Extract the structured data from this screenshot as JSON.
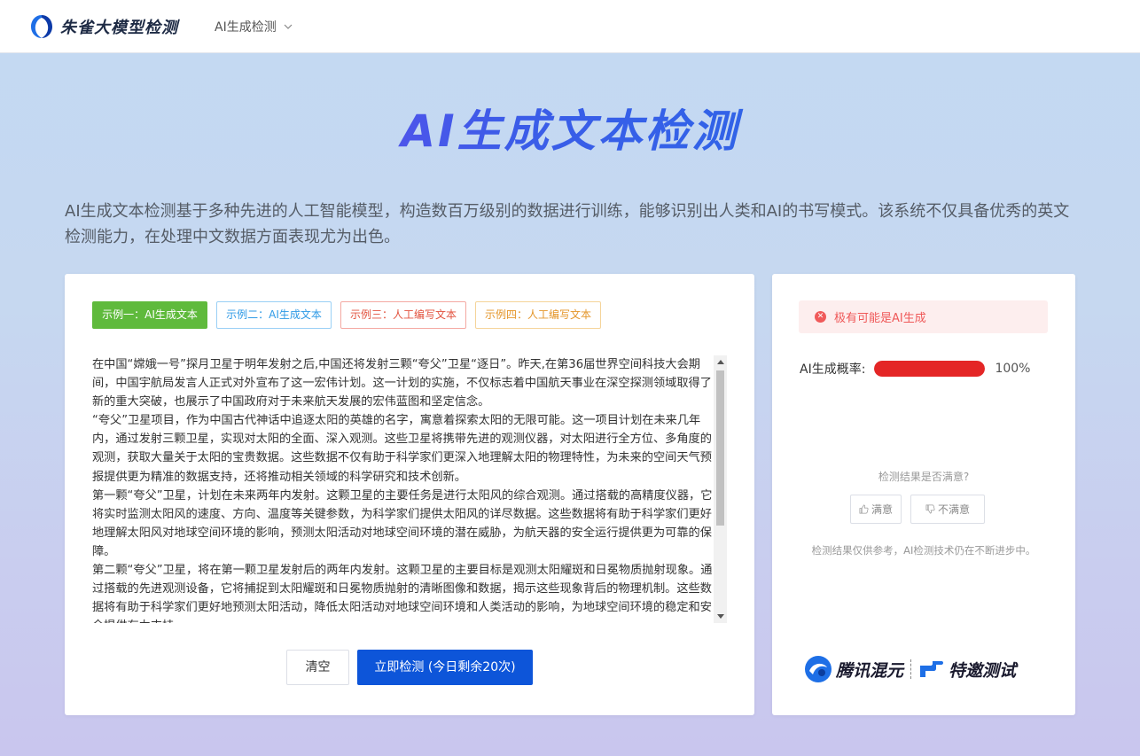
{
  "header": {
    "brand": "朱雀大模型检测",
    "nav_item": "AI生成检测"
  },
  "hero": {
    "title": "AI生成文本检测",
    "description": "AI生成文本检测基于多种先进的人工智能模型，构造数百万级别的数据进行训练，能够识别出人类和AI的书写模式。该系统不仅具备优秀的英文检测能力，在处理中文数据方面表现尤为出色。"
  },
  "examples": [
    {
      "label": "示例一：AI生成文本"
    },
    {
      "label": "示例二：AI生成文本"
    },
    {
      "label": "示例三：人工编写文本"
    },
    {
      "label": "示例四：人工编写文本"
    }
  ],
  "input": {
    "text": "在中国“嫦娥一号”探月卫星于明年发射之后,中国还将发射三颗“夸父”卫星“逐日”。昨天,在第36届世界空间科技大会期间，中国宇航局发言人正式对外宣布了这一宏伟计划。这一计划的实施，不仅标志着中国航天事业在深空探测领域取得了新的重大突破，也展示了中国政府对于未来航天发展的宏伟蓝图和坚定信念。\n“夸父”卫星项目，作为中国古代神话中追逐太阳的英雄的名字，寓意着探索太阳的无限可能。这一项目计划在未来几年内，通过发射三颗卫星，实现对太阳的全面、深入观测。这些卫星将携带先进的观测仪器，对太阳进行全方位、多角度的观测，获取大量关于太阳的宝贵数据。这些数据不仅有助于科学家们更深入地理解太阳的物理特性，为未来的空间天气预报提供更为精准的数据支持，还将推动相关领域的科学研究和技术创新。\n第一颗“夸父”卫星，计划在未来两年内发射。这颗卫星的主要任务是进行太阳风的综合观测。通过搭载的高精度仪器，它将实时监测太阳风的速度、方向、温度等关键参数，为科学家们提供太阳风的详尽数据。这些数据将有助于科学家们更好地理解太阳风对地球空间环境的影响，预测太阳活动对地球空间环境的潜在威胁，为航天器的安全运行提供更为可靠的保障。\n第二颗“夸父”卫星，将在第一颗卫星发射后的两年内发射。这颗卫星的主要目标是观测太阳耀斑和日冕物质抛射现象。通过搭载的先进观测设备，它将捕捉到太阳耀斑和日冕物质抛射的清晰图像和数据，揭示这些现象背后的物理机制。这些数据将有助于科学家们更好地预测太阳活动，降低太阳活动对地球空间环境和人类活动的影响，为地球空间环境的稳定和安全提供有力支持。"
  },
  "actions": {
    "clear_label": "清空",
    "detect_label": "立即检测 (今日剩余20次)"
  },
  "result": {
    "alert_text": "极有可能是AI生成",
    "prob_label": "AI生成概率:",
    "prob_value_text": "100%",
    "prob_fraction": 1.0,
    "prob_color": "#e42626",
    "satisfaction_question": "检测结果是否满意?",
    "satisfied_label": "满意",
    "unsatisfied_label": "不满意",
    "disclaimer": "检测结果仅供参考，AI检测技术仍在不断进步中。"
  },
  "partners": {
    "partner_1": "腾讯混元",
    "partner_2": "特邀测试"
  },
  "colors": {
    "primary": "#0d55d9",
    "success_tag": "#5fba3c",
    "danger": "#ef5858"
  }
}
